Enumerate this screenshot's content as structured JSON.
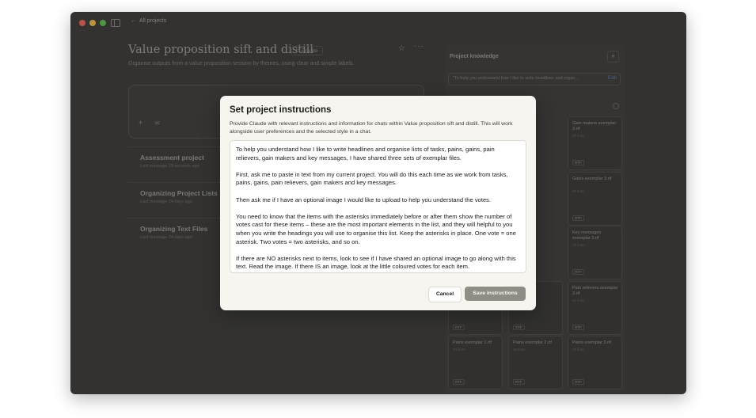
{
  "nav": {
    "back_label": "All projects"
  },
  "project": {
    "title": "Value proposition sift and distill",
    "visibility": "Private",
    "description": "Organise outputs from a value proposition session by themes, using clear and simple labels."
  },
  "chats": [
    {
      "name": "Assessment project",
      "time": "Last message 29 seconds ago"
    },
    {
      "name": "Organizing Project Lists",
      "time": "Last message 24 days ago"
    },
    {
      "name": "Organizing Text Files",
      "time": "Last message 24 days ago"
    }
  ],
  "knowledge": {
    "title": "Project knowledge",
    "add_label": "+",
    "instructions_preview": "\"To help you understand how I like to write headlines and organ...",
    "edit_label": "Edit",
    "files": [
      {
        "name": "Gain makers exemplar 3.rtf",
        "lines": "37 lines",
        "type": "RTF"
      },
      {
        "name": "Gains exemplar 3.rtf",
        "lines": "40 lines",
        "type": "RTF"
      },
      {
        "name": "Key messages exemplar 3.rtf",
        "lines": "70 lines",
        "type": "RTF"
      },
      {
        "name": "Pain relievers exemplar 3.rtf",
        "lines": "41 lines",
        "type": "RTF"
      },
      {
        "name": "Pains exemplar 1.rtf",
        "lines": "40 lines",
        "type": "RTF"
      },
      {
        "name": "Pains exemplar 2.rtf",
        "lines": "30 lines",
        "type": "RTF"
      },
      {
        "name": "Pains exemplar 3.rtf",
        "lines": "70 lines",
        "type": "RTF"
      },
      {
        "name": "",
        "lines": "",
        "type": "RTF"
      },
      {
        "name": "",
        "lines": "",
        "type": "RTF"
      }
    ]
  },
  "modal": {
    "title": "Set project instructions",
    "description": "Provide Claude with relevant instructions and information for chats within Value proposition sift and distill. This will work alongside user preferences and the selected style in a chat.",
    "instructions": "To help you understand how I like to write headlines and organise lists of tasks, pains, gains, pain relievers, gain makers and key messages, I have shared three sets of exemplar files.\n\nFirst, ask me to paste in text from my current project. You will do this each time as we work from tasks, pains, gains, pain relievers, gain makers and key messages.\n\nThen ask me if I have an optional image I would like to upload to help you understand the votes.\n\nYou need to know that the items with the asterisks immediately before or after them show the number of votes cast for these items – these are the most important elements in the list, and they will helpful to you when you write the headings you will use to organise this list. Keep the asterisks in place. One vote = one asterisk. Two votes = two asterisks, and so on.\n\nIf there are NO asterisks next to items, look to see if I have shared an optional image to go along with this text. Read the image. If there IS an image, look at the little coloured votes for each item.",
    "cancel_label": "Cancel",
    "save_label": "Save instructions"
  }
}
